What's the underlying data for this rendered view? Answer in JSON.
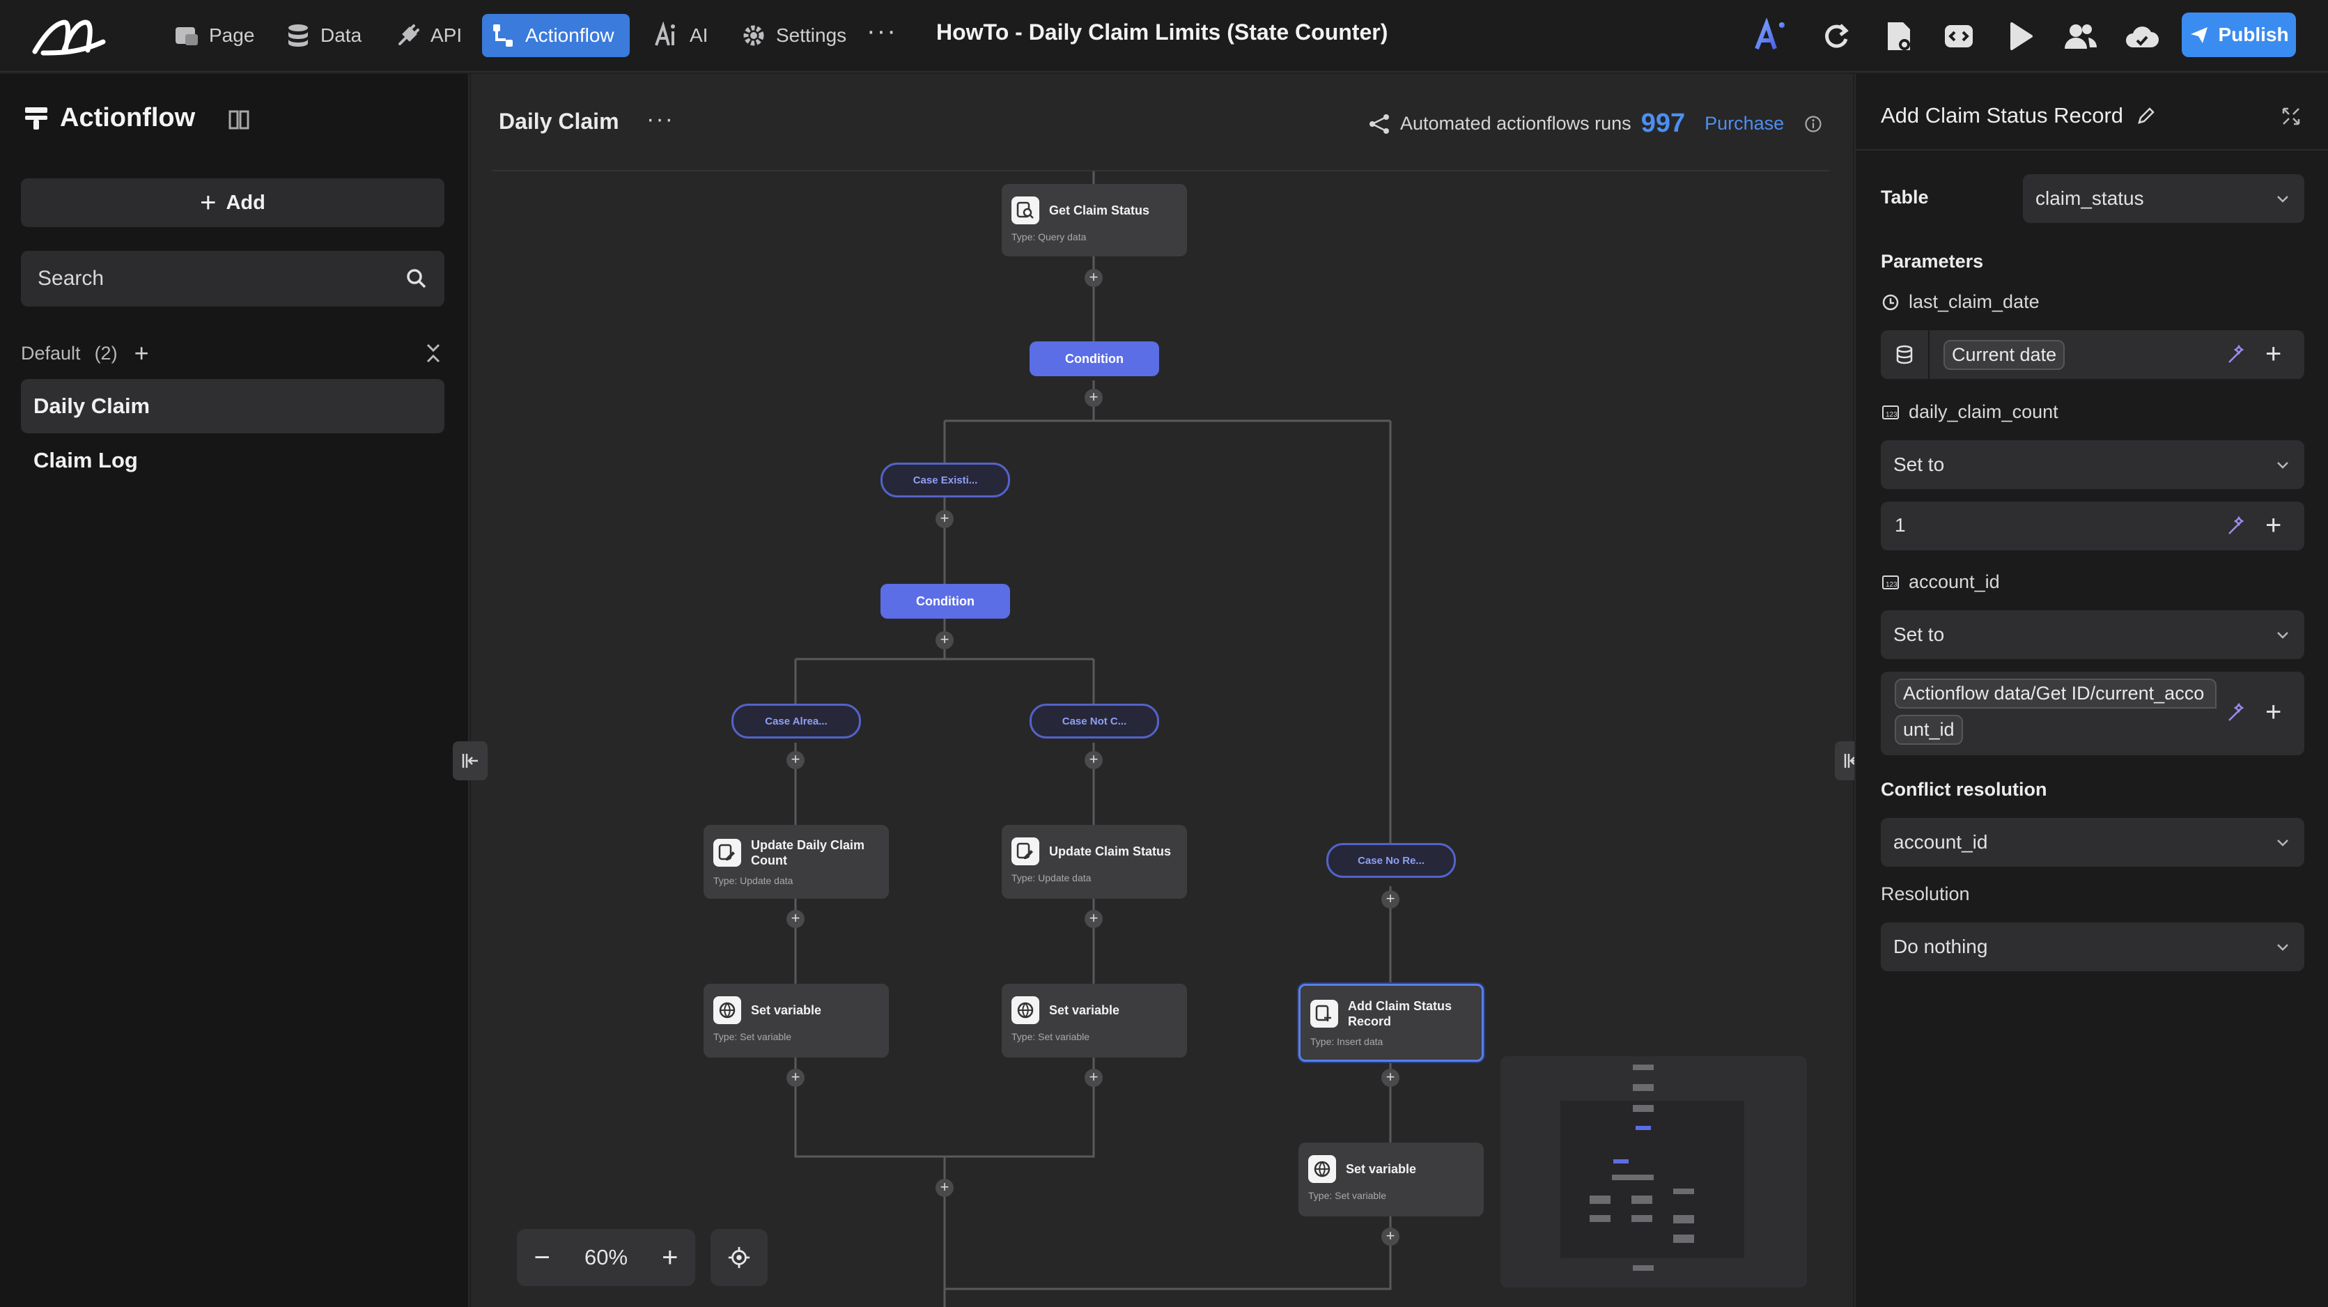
{
  "topbar": {
    "nav": [
      {
        "label": "Page",
        "icon": "page-icon"
      },
      {
        "label": "Data",
        "icon": "database-icon"
      },
      {
        "label": "API",
        "icon": "api-plug-icon"
      },
      {
        "label": "Actionflow",
        "icon": "actionflow-icon",
        "active": true
      },
      {
        "label": "AI",
        "icon": "ai-icon"
      },
      {
        "label": "Settings",
        "icon": "gear-icon"
      }
    ],
    "more": "···",
    "doc_title": "HowTo - Daily Claim Limits (State Counter)",
    "publish_label": "Publish",
    "accent": "#3a8cf0"
  },
  "left": {
    "title": "Actionflow",
    "add_label": "Add",
    "search_placeholder": "Search",
    "group_name": "Default",
    "group_count": "(2)",
    "items": [
      {
        "label": "Daily Claim",
        "active": true
      },
      {
        "label": "Claim Log",
        "active": false
      }
    ]
  },
  "canvas": {
    "title": "Daily Claim",
    "dots": "···",
    "runs_label": "Automated actionflows runs",
    "runs_count": "997",
    "purchase_label": "Purchase",
    "zoom": "60%",
    "nodes": {
      "get_claim_status": {
        "label": "Get Claim Status",
        "type": "Type:  Query data"
      },
      "update_daily": {
        "label": "Update Daily Claim Count",
        "type": "Type:  Update data"
      },
      "update_status": {
        "label": "Update Claim Status",
        "type": "Type:  Update data"
      },
      "set_var_1": {
        "label": "Set variable",
        "type": "Type:  Set variable"
      },
      "set_var_2": {
        "label": "Set variable",
        "type": "Type:  Set variable"
      },
      "add_claim": {
        "label": "Add Claim Status Record",
        "type": "Type:  Insert data"
      },
      "set_var_3": {
        "label": "Set variable",
        "type": "Type:  Set variable"
      }
    },
    "conditions": [
      "Condition",
      "Condition"
    ],
    "cases": [
      "Case Existi...",
      "Case Alrea...",
      "Case Not C...",
      "Case No Re..."
    ]
  },
  "panel": {
    "title": "Add Claim Status Record",
    "table_label": "Table",
    "table_value": "claim_status",
    "parameters_label": "Parameters",
    "param1_name": "last_claim_date",
    "param1_value": "Current date",
    "param2_name": "daily_claim_count",
    "param2_mode": "Set to",
    "param2_value": "1",
    "param3_name": "account_id",
    "param3_mode": "Set to",
    "param3_value_line1": "Actionflow data/Get ID/current_acco",
    "param3_value_line2": "unt_id",
    "conflict_label": "Conflict resolution",
    "conflict_value": "account_id",
    "resolution_label": "Resolution",
    "resolution_value": "Do nothing"
  }
}
